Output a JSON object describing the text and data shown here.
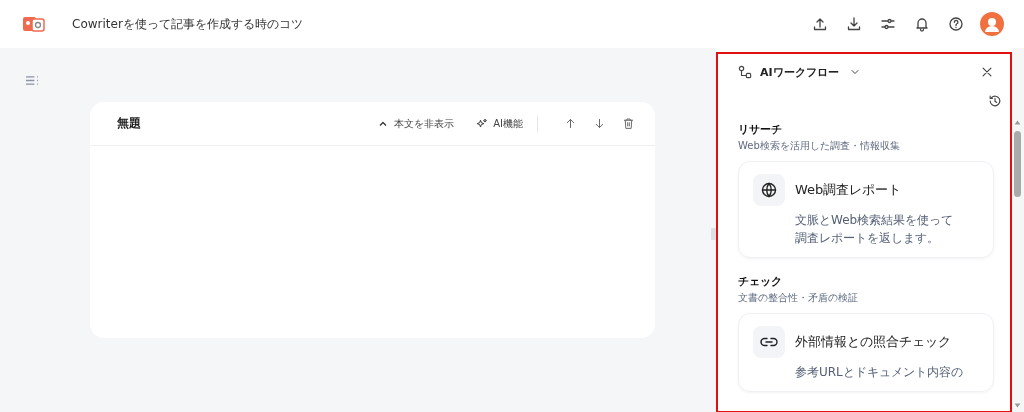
{
  "header": {
    "title": "Cowriterを使って記事を作成する時のコツ"
  },
  "editor": {
    "title": "無題",
    "actions": [
      {
        "kind": "collapse",
        "label": "本文を非表示"
      },
      {
        "kind": "ai",
        "label": "AI機能"
      }
    ]
  },
  "panel": {
    "title": "AIワークフロー",
    "sections": [
      {
        "heading": "リサーチ",
        "description": "Web検索を活用した調査・情報収集",
        "items": [
          {
            "kind": "globe",
            "title": "Web調査レポート",
            "description_lines": [
              "文脈とWeb検索結果を使って",
              "調査レポートを返します。"
            ]
          }
        ]
      },
      {
        "heading": "チェック",
        "description": "文書の整合性・矛盾の検証",
        "items": [
          {
            "kind": "link",
            "title": "外部情報との照合チェック",
            "description_lines": [
              "参考URLとドキュメント内容の"
            ]
          }
        ]
      }
    ]
  }
}
